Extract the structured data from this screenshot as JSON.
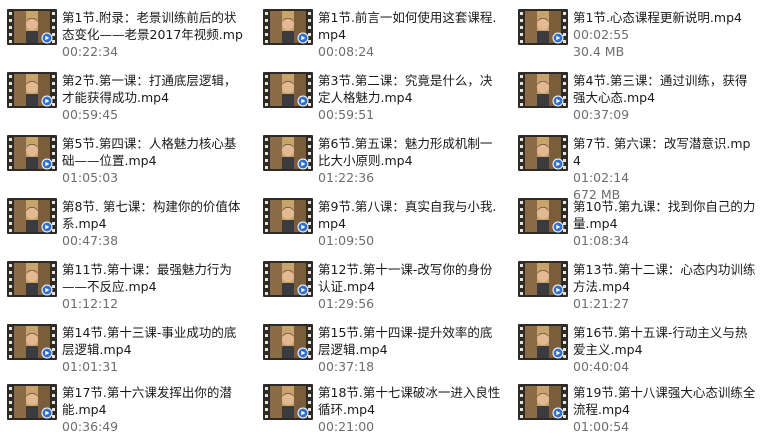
{
  "files": [
    {
      "name": "第1节.附录：老景训练前后的状态变化——老景2017年视频.mp4",
      "detail": "00:22:34"
    },
    {
      "name": "第1节.前言一如何使用这套课程.mp4",
      "detail": "00:08:24"
    },
    {
      "name": "第1节.心态课程更新说明.mp4",
      "detail": "00:02:55",
      "size": "30.4 MB"
    },
    {
      "name": "第2节.第一课：打通底层逻辑，才能获得成功.mp4",
      "detail": "00:59:45"
    },
    {
      "name": "第3节.第二课：究竟是什么，决定人格魅力.mp4",
      "detail": "00:59:51"
    },
    {
      "name": "第4节.第三课：通过训练，获得强大心态.mp4",
      "detail": "00:37:09"
    },
    {
      "name": "第5节.第四课：人格魅力核心基础——位置.mp4",
      "detail": "01:05:03"
    },
    {
      "name": "第6节.第五课：魅力形成机制一比大小原则.mp4",
      "detail": "01:22:36"
    },
    {
      "name": "第7节. 第六课：改写潜意识.mp4",
      "detail": "01:02:14",
      "size": "672 MB"
    },
    {
      "name": "第8节. 第七课：构建你的价值体系.mp4",
      "detail": "00:47:38"
    },
    {
      "name": "第9节.第八课：真实自我与小我.mp4",
      "detail": "01:09:50"
    },
    {
      "name": "第10节.第九课：找到你自己的力量.mp4",
      "detail": "01:08:34"
    },
    {
      "name": "第11节.第十课：最强魅力行为——不反应.mp4",
      "detail": "01:12:12"
    },
    {
      "name": "第12节.第十一课-改写你的身份认证.mp4",
      "detail": "01:29:56"
    },
    {
      "name": "第13节.第十二课：心态内功训练方法.mp4",
      "detail": "01:21:27"
    },
    {
      "name": "第14节.第十三课-事业成功的底层逻辑.mp4",
      "detail": "01:01:31"
    },
    {
      "name": "第15节.第十四课-提升效率的底层逻辑.mp4",
      "detail": "00:37:18"
    },
    {
      "name": "第16节.第十五课-行动主义与热爱主义.mp4",
      "detail": "00:40:04"
    },
    {
      "name": "第17节.第十六课发挥出你的潜能.mp4",
      "detail": "00:36:49"
    },
    {
      "name": "第18节.第十七课破冰一进入良性循环.mp4",
      "detail": "00:21:00"
    },
    {
      "name": "第19节.第十八课强大心态训练全流程.mp4",
      "detail": "01:00:54"
    }
  ]
}
